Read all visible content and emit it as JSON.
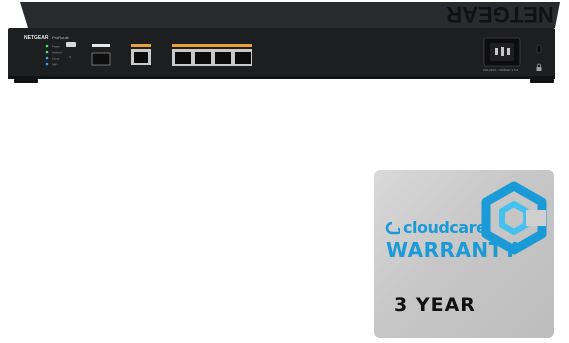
{
  "product": {
    "brand": "NETGEAR",
    "model": "ProRoute",
    "panel_logo": "NETGEAR",
    "led_labels": [
      "Power",
      "Internet",
      "Cloud",
      "WiFi"
    ],
    "port_color_wan": "#e8a23a",
    "port_color_lan": "#e8a23a",
    "body_color": "#1d1e20",
    "power_rating": "100-240V ~ 50/60Hz 1.5 A"
  },
  "badge": {
    "brand": "cloudcare",
    "title": "WARRANTY",
    "term": "3 YEAR",
    "accent_color": "#1a9ad6",
    "icon": "cloudcare-logo-icon"
  }
}
